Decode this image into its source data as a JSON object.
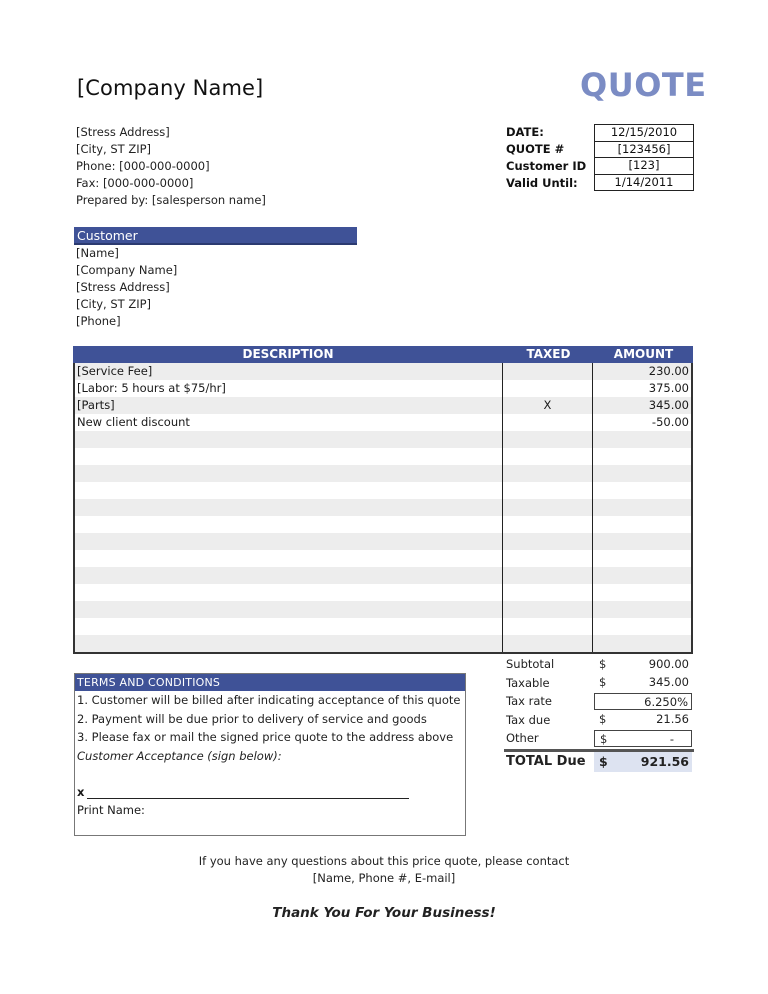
{
  "header": {
    "company_name": "[Company Name]",
    "doc_title": "QUOTE",
    "address_lines": [
      "[Stress Address]",
      "[City, ST  ZIP]",
      "Phone: [000-000-0000]",
      "Fax: [000-000-0000]",
      "Prepared by: [salesperson name]"
    ]
  },
  "meta": {
    "fields": [
      {
        "label": "DATE:",
        "value": "12/15/2010"
      },
      {
        "label": "QUOTE #",
        "value": "[123456]"
      },
      {
        "label": "Customer ID",
        "value": "[123]"
      },
      {
        "label": "Valid Until:",
        "value": "1/14/2011"
      }
    ]
  },
  "customer": {
    "heading": "Customer",
    "lines": [
      "[Name]",
      "[Company Name]",
      "[Stress Address]",
      "[City, ST  ZIP]",
      "[Phone]"
    ]
  },
  "items": {
    "headers": {
      "description": "DESCRIPTION",
      "taxed": "TAXED",
      "amount": "AMOUNT"
    },
    "rows": [
      {
        "description": "[Service Fee]",
        "taxed": "",
        "amount": "230.00"
      },
      {
        "description": "[Labor: 5 hours at $75/hr]",
        "taxed": "",
        "amount": "375.00"
      },
      {
        "description": "[Parts]",
        "taxed": "X",
        "amount": "345.00"
      },
      {
        "description": "New client discount",
        "taxed": "",
        "amount": "-50.00"
      },
      {
        "description": "",
        "taxed": "",
        "amount": ""
      },
      {
        "description": "",
        "taxed": "",
        "amount": ""
      },
      {
        "description": "",
        "taxed": "",
        "amount": ""
      },
      {
        "description": "",
        "taxed": "",
        "amount": ""
      },
      {
        "description": "",
        "taxed": "",
        "amount": ""
      },
      {
        "description": "",
        "taxed": "",
        "amount": ""
      },
      {
        "description": "",
        "taxed": "",
        "amount": ""
      },
      {
        "description": "",
        "taxed": "",
        "amount": ""
      },
      {
        "description": "",
        "taxed": "",
        "amount": ""
      },
      {
        "description": "",
        "taxed": "",
        "amount": ""
      },
      {
        "description": "",
        "taxed": "",
        "amount": ""
      },
      {
        "description": "",
        "taxed": "",
        "amount": ""
      },
      {
        "description": "",
        "taxed": "",
        "amount": ""
      }
    ]
  },
  "terms": {
    "heading": "TERMS AND CONDITIONS",
    "lines": [
      "1. Customer will be billed after indicating acceptance of this quote",
      "2. Payment will be due prior to delivery of service and goods",
      "3. Please fax or mail the signed price quote to the address above"
    ],
    "acceptance": "Customer Acceptance (sign below):",
    "sign_prefix": "x",
    "print_name": "Print Name:"
  },
  "totals": {
    "currency": "$",
    "subtotal_label": "Subtotal",
    "subtotal": "900.00",
    "taxable_label": "Taxable",
    "taxable": "345.00",
    "tax_rate_label": "Tax rate",
    "tax_rate": "6.250%",
    "tax_due_label": "Tax due",
    "tax_due": "21.56",
    "other_label": "Other",
    "other": "-",
    "total_label": "TOTAL Due",
    "total": "921.56"
  },
  "footer": {
    "question_line": "If you have any questions about this price quote, please contact",
    "contact_line": "[Name, Phone #, E-mail]",
    "thanks": "Thank You For Your Business!"
  },
  "colors": {
    "accent": "#3f5297",
    "title": "#7b8cc4",
    "total_bg": "#dde3f1",
    "stripe": "#ededed"
  }
}
